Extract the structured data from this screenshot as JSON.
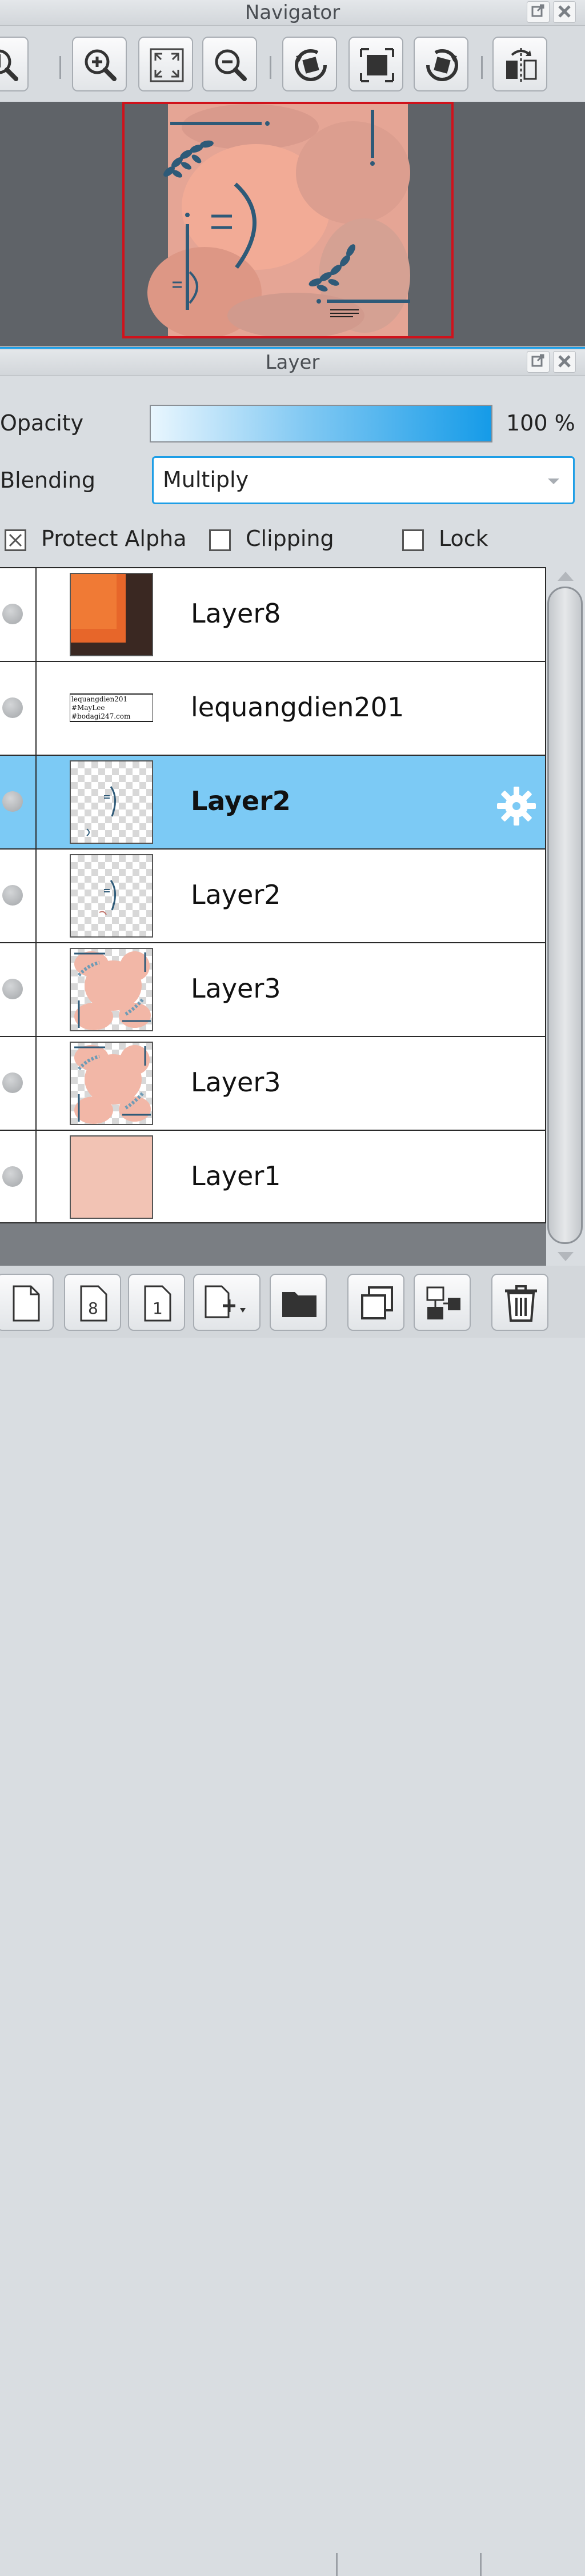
{
  "navigator": {
    "title": "Navigator",
    "toolbar_icons": [
      "actual-size-icon",
      "zoom-in-icon",
      "fit-to-window-icon",
      "zoom-out-icon",
      "rotate-left-icon",
      "fit-canvas-icon",
      "rotate-right-icon",
      "flip-horizontal-icon"
    ]
  },
  "layer_panel": {
    "title": "Layer",
    "opacity_label": "Opacity",
    "opacity_value": "100 %",
    "blending_label": "Blending",
    "blending_value": "Multiply",
    "protect_alpha_label": "Protect Alpha",
    "clipping_label": "Clipping",
    "lock_label": "Lock",
    "protect_alpha_checked": true,
    "clipping_checked": false,
    "lock_checked": false
  },
  "layers": [
    {
      "name": "Layer8",
      "selected": false,
      "thumb": "orange-dark"
    },
    {
      "name": "lequangdien201",
      "selected": false,
      "thumb": "text"
    },
    {
      "name": "Layer2",
      "selected": true,
      "thumb": "transparent-art"
    },
    {
      "name": "Layer2",
      "selected": false,
      "thumb": "transparent-art"
    },
    {
      "name": "Layer3",
      "selected": false,
      "thumb": "peach-pattern"
    },
    {
      "name": "Layer3",
      "selected": false,
      "thumb": "peach-pattern"
    },
    {
      "name": "Layer1",
      "selected": false,
      "thumb": "peach-solid"
    }
  ],
  "thumb_text_lines": [
    "lequangdien201",
    "#MayLee",
    "#bodagi247.com"
  ],
  "colors": {
    "accent": "#1e9ee6",
    "selection": "#7ccaf5",
    "preview_frame": "#d0121b",
    "peach": "#f2c3b4",
    "navy": "#2e5a78"
  },
  "bottom_toolbar_icons": [
    "new-layer-icon",
    "new-8bit-layer-icon",
    "new-1bit-layer-icon",
    "add-layer-dropdown-icon",
    "new-folder-icon",
    "duplicate-layer-icon",
    "merge-layer-icon",
    "delete-layer-icon"
  ]
}
